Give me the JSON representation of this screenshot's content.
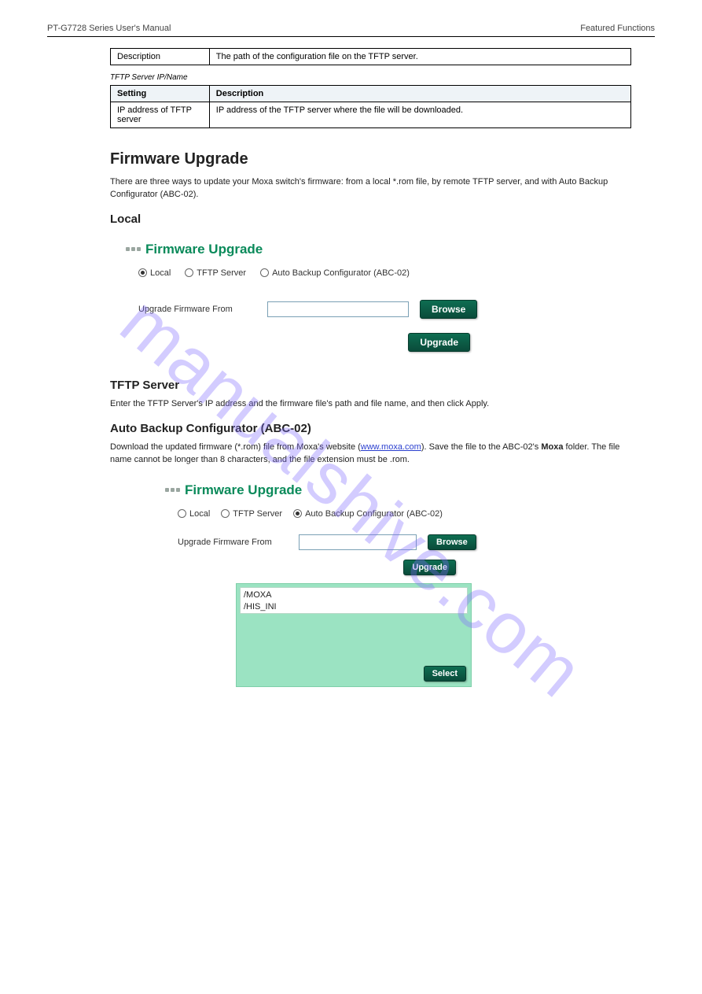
{
  "header": {
    "left": "PT-G7728 Series User's Manual",
    "right": "Featured Functions"
  },
  "tables": {
    "config_file_path": {
      "rows": [
        [
          "Description",
          "The path of the configuration file on the TFTP server."
        ]
      ]
    },
    "tftp_server": {
      "title": "TFTP Server IP/Name",
      "rows": [
        [
          "Setting",
          "Description"
        ],
        [
          "IP address of TFTP server",
          "IP address of the TFTP server where the file will be downloaded."
        ]
      ]
    }
  },
  "sections": {
    "firmware_upgrade": "Firmware Upgrade",
    "local_title": "Local",
    "tftp_title": "TFTP Server",
    "abc_title": "Auto Backup Configurator (ABC-02)",
    "intro": "There are three ways to update your Moxa switch's firmware: from a local *.rom file, by remote TFTP server, and with Auto Backup Configurator (ABC-02).",
    "tftp_body1": "Enter the TFTP Server's IP address and the firmware file's path and file name, and then click Apply.",
    "abc_body1_pre": "Download the updated firmware (*.rom) file from Moxa's website (",
    "abc_link": "www.moxa.com",
    "abc_body1_post": "). Save the file to the ABC-02's ",
    "abc_body2_prefix": "Moxa ",
    "abc_body2_rest": "folder. The file name cannot be longer than 8 characters, and the file extension must be .rom."
  },
  "panel1": {
    "title": "Firmware Upgrade",
    "radios": {
      "local": "Local",
      "tftp": "TFTP Server",
      "abc": "Auto Backup Configurator (ABC-02)"
    },
    "selected": "local",
    "label": "Upgrade Firmware From",
    "browse": "Browse",
    "upgrade": "Upgrade"
  },
  "panel2": {
    "title": "Firmware Upgrade",
    "radios": {
      "local": "Local",
      "tftp": "TFTP Server",
      "abc": "Auto Backup Configurator (ABC-02)"
    },
    "selected": "abc",
    "label": "Upgrade Firmware From",
    "browse": "Browse",
    "upgrade": "Upgrade",
    "files": [
      "/MOXA",
      "/HIS_INI"
    ],
    "select": "Select"
  },
  "watermark": "manualshive.com"
}
